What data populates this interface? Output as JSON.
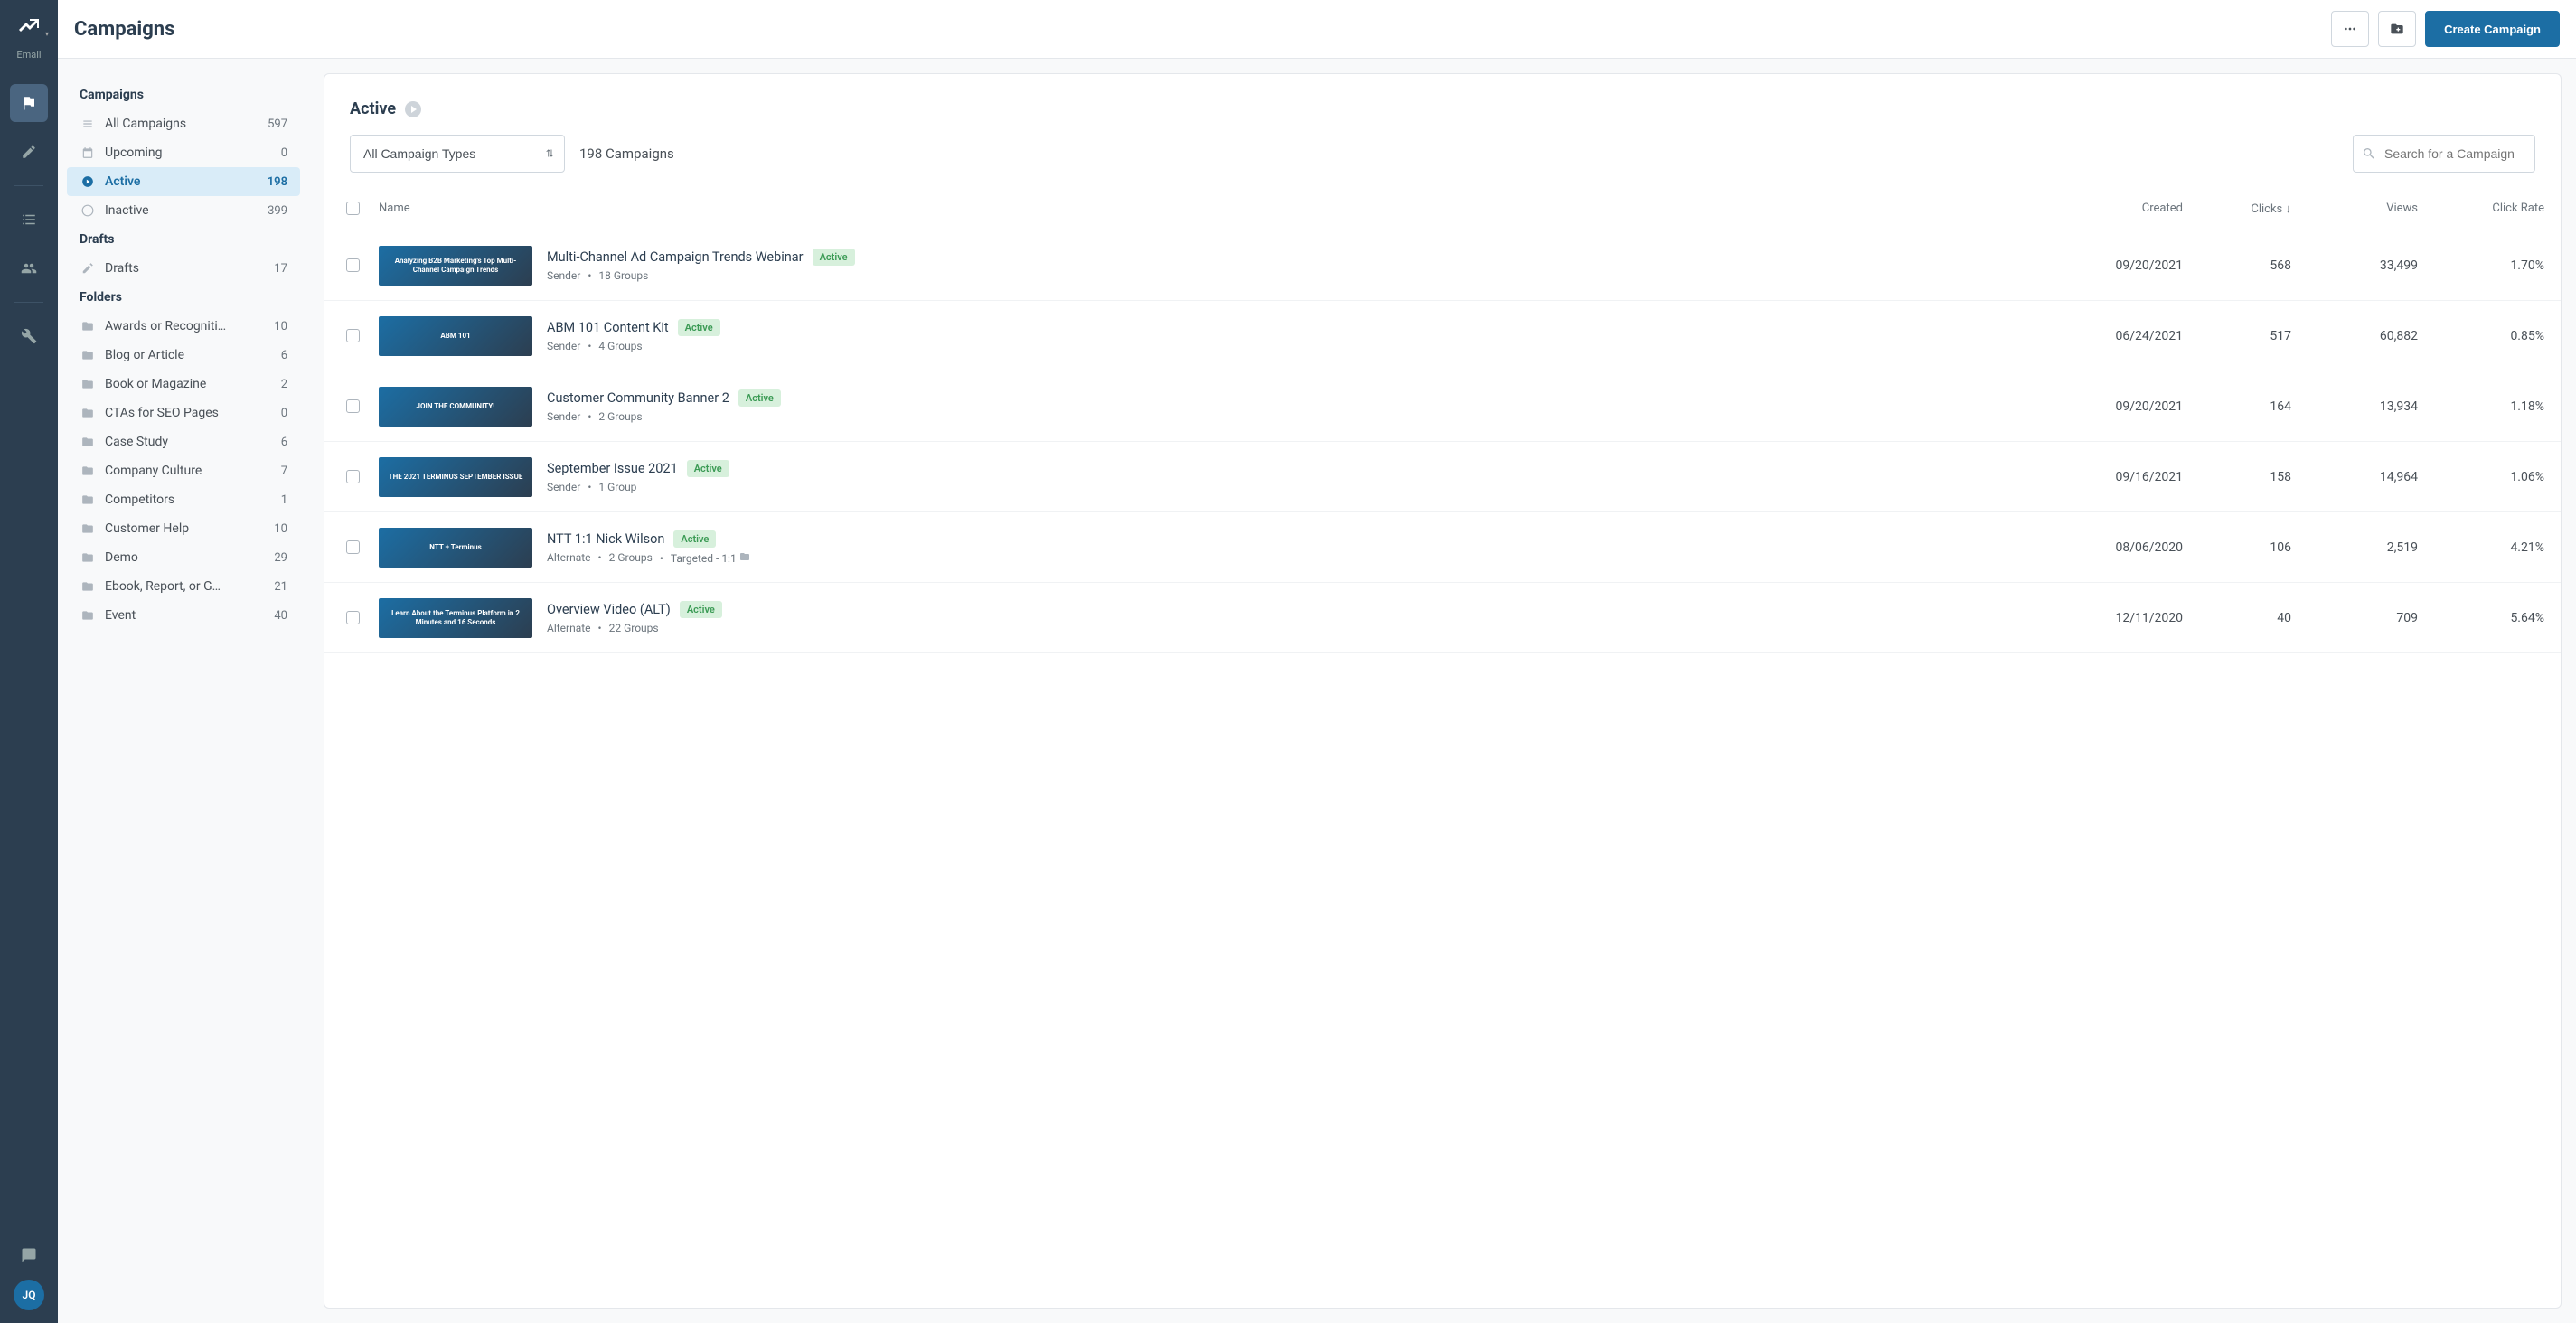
{
  "rail": {
    "app_label": "Email",
    "avatar": "JQ"
  },
  "header": {
    "title": "Campaigns",
    "create_label": "Create Campaign"
  },
  "sidebar": {
    "sections": [
      {
        "title": "Campaigns",
        "items": [
          {
            "icon": "list",
            "label": "All Campaigns",
            "count": "597",
            "selected": false
          },
          {
            "icon": "calendar",
            "label": "Upcoming",
            "count": "0",
            "selected": false
          },
          {
            "icon": "play",
            "label": "Active",
            "count": "198",
            "selected": true
          },
          {
            "icon": "stop",
            "label": "Inactive",
            "count": "399",
            "selected": false
          }
        ]
      },
      {
        "title": "Drafts",
        "items": [
          {
            "icon": "pencil-ruler",
            "label": "Drafts",
            "count": "17"
          }
        ]
      },
      {
        "title": "Folders",
        "items": [
          {
            "icon": "folder",
            "label": "Awards or Recogniti…",
            "count": "10"
          },
          {
            "icon": "folder",
            "label": "Blog or Article",
            "count": "6"
          },
          {
            "icon": "folder",
            "label": "Book or Magazine",
            "count": "2"
          },
          {
            "icon": "folder",
            "label": "CTAs for SEO Pages",
            "count": "0"
          },
          {
            "icon": "folder",
            "label": "Case Study",
            "count": "6"
          },
          {
            "icon": "folder",
            "label": "Company Culture",
            "count": "7"
          },
          {
            "icon": "folder",
            "label": "Competitors",
            "count": "1"
          },
          {
            "icon": "folder",
            "label": "Customer Help",
            "count": "10"
          },
          {
            "icon": "folder",
            "label": "Demo",
            "count": "29"
          },
          {
            "icon": "folder",
            "label": "Ebook, Report, or G…",
            "count": "21"
          },
          {
            "icon": "folder",
            "label": "Event",
            "count": "40"
          }
        ]
      }
    ]
  },
  "content": {
    "title": "Active",
    "filter_select": "All Campaign Types",
    "count_label": "198 Campaigns",
    "search_placeholder": "Search for a Campaign",
    "columns": {
      "name": "Name",
      "created": "Created",
      "clicks": "Clicks ↓",
      "views": "Views",
      "click_rate": "Click Rate"
    },
    "rows": [
      {
        "thumb_text": "Analyzing B2B Marketing's Top Multi-Channel Campaign Trends",
        "name": "Multi-Channel Ad Campaign Trends Webinar",
        "status": "Active",
        "meta1": "Sender",
        "meta2": "18 Groups",
        "targeted": "",
        "created": "09/20/2021",
        "clicks": "568",
        "views": "33,499",
        "rate": "1.70%"
      },
      {
        "thumb_text": "ABM 101",
        "name": "ABM 101 Content Kit",
        "status": "Active",
        "meta1": "Sender",
        "meta2": "4 Groups",
        "targeted": "",
        "created": "06/24/2021",
        "clicks": "517",
        "views": "60,882",
        "rate": "0.85%"
      },
      {
        "thumb_text": "JOIN THE COMMUNITY!",
        "name": "Customer Community Banner 2",
        "status": "Active",
        "meta1": "Sender",
        "meta2": "2 Groups",
        "targeted": "",
        "created": "09/20/2021",
        "clicks": "164",
        "views": "13,934",
        "rate": "1.18%"
      },
      {
        "thumb_text": "THE 2021 TERMINUS SEPTEMBER ISSUE",
        "name": "September Issue 2021",
        "status": "Active",
        "meta1": "Sender",
        "meta2": "1 Group",
        "targeted": "",
        "created": "09/16/2021",
        "clicks": "158",
        "views": "14,964",
        "rate": "1.06%"
      },
      {
        "thumb_text": "NTT + Terminus",
        "name": "NTT 1:1 Nick Wilson",
        "status": "Active",
        "meta1": "Alternate",
        "meta2": "2 Groups",
        "targeted": "Targeted - 1:1",
        "created": "08/06/2020",
        "clicks": "106",
        "views": "2,519",
        "rate": "4.21%"
      },
      {
        "thumb_text": "Learn About the Terminus Platform in 2 Minutes and 16 Seconds",
        "name": "Overview Video (ALT)",
        "status": "Active",
        "meta1": "Alternate",
        "meta2": "22 Groups",
        "targeted": "",
        "created": "12/11/2020",
        "clicks": "40",
        "views": "709",
        "rate": "5.64%"
      }
    ]
  }
}
